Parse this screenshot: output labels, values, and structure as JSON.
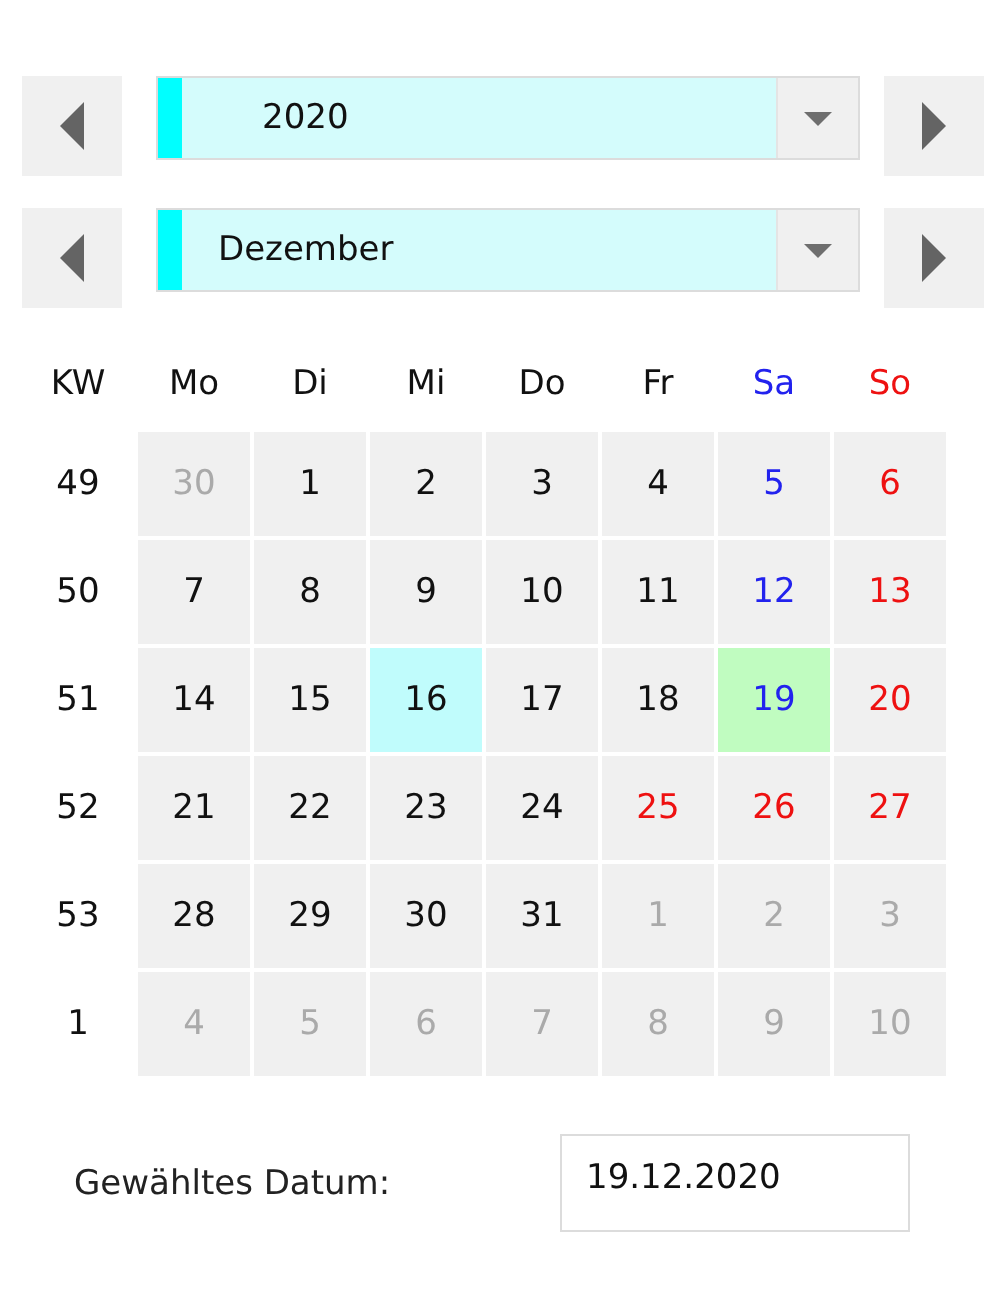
{
  "selectors": [
    {
      "kind": "year",
      "value": "2020"
    },
    {
      "kind": "month",
      "value": "Dezember"
    }
  ],
  "calendar": {
    "header": [
      {
        "label": "KW",
        "kind": "week"
      },
      {
        "label": "Mo",
        "kind": "weekday"
      },
      {
        "label": "Di",
        "kind": "weekday"
      },
      {
        "label": "Mi",
        "kind": "weekday"
      },
      {
        "label": "Do",
        "kind": "weekday"
      },
      {
        "label": "Fr",
        "kind": "weekday"
      },
      {
        "label": "Sa",
        "kind": "saturday"
      },
      {
        "label": "So",
        "kind": "sunday"
      }
    ],
    "weeks": [
      {
        "week": "49",
        "days": [
          {
            "label": "30",
            "kind": "outside",
            "today": false,
            "selected": false
          },
          {
            "label": "1",
            "kind": "weekday",
            "today": false,
            "selected": false
          },
          {
            "label": "2",
            "kind": "weekday",
            "today": false,
            "selected": false
          },
          {
            "label": "3",
            "kind": "weekday",
            "today": false,
            "selected": false
          },
          {
            "label": "4",
            "kind": "weekday",
            "today": false,
            "selected": false
          },
          {
            "label": "5",
            "kind": "saturday",
            "today": false,
            "selected": false
          },
          {
            "label": "6",
            "kind": "sunday",
            "today": false,
            "selected": false
          }
        ]
      },
      {
        "week": "50",
        "days": [
          {
            "label": "7",
            "kind": "weekday",
            "today": false,
            "selected": false
          },
          {
            "label": "8",
            "kind": "weekday",
            "today": false,
            "selected": false
          },
          {
            "label": "9",
            "kind": "weekday",
            "today": false,
            "selected": false
          },
          {
            "label": "10",
            "kind": "weekday",
            "today": false,
            "selected": false
          },
          {
            "label": "11",
            "kind": "weekday",
            "today": false,
            "selected": false
          },
          {
            "label": "12",
            "kind": "saturday",
            "today": false,
            "selected": false
          },
          {
            "label": "13",
            "kind": "sunday",
            "today": false,
            "selected": false
          }
        ]
      },
      {
        "week": "51",
        "days": [
          {
            "label": "14",
            "kind": "weekday",
            "today": false,
            "selected": false
          },
          {
            "label": "15",
            "kind": "weekday",
            "today": false,
            "selected": false
          },
          {
            "label": "16",
            "kind": "weekday",
            "today": true,
            "selected": false
          },
          {
            "label": "17",
            "kind": "weekday",
            "today": false,
            "selected": false
          },
          {
            "label": "18",
            "kind": "weekday",
            "today": false,
            "selected": false
          },
          {
            "label": "19",
            "kind": "saturday",
            "today": false,
            "selected": true
          },
          {
            "label": "20",
            "kind": "sunday",
            "today": false,
            "selected": false
          }
        ]
      },
      {
        "week": "52",
        "days": [
          {
            "label": "21",
            "kind": "weekday",
            "today": false,
            "selected": false
          },
          {
            "label": "22",
            "kind": "weekday",
            "today": false,
            "selected": false
          },
          {
            "label": "23",
            "kind": "weekday",
            "today": false,
            "selected": false
          },
          {
            "label": "24",
            "kind": "weekday",
            "today": false,
            "selected": false
          },
          {
            "label": "25",
            "kind": "holiday",
            "today": false,
            "selected": false
          },
          {
            "label": "26",
            "kind": "holiday",
            "today": false,
            "selected": false
          },
          {
            "label": "27",
            "kind": "sunday",
            "today": false,
            "selected": false
          }
        ]
      },
      {
        "week": "53",
        "days": [
          {
            "label": "28",
            "kind": "weekday",
            "today": false,
            "selected": false
          },
          {
            "label": "29",
            "kind": "weekday",
            "today": false,
            "selected": false
          },
          {
            "label": "30",
            "kind": "weekday",
            "today": false,
            "selected": false
          },
          {
            "label": "31",
            "kind": "weekday",
            "today": false,
            "selected": false
          },
          {
            "label": "1",
            "kind": "outside",
            "today": false,
            "selected": false
          },
          {
            "label": "2",
            "kind": "outside",
            "today": false,
            "selected": false
          },
          {
            "label": "3",
            "kind": "outside",
            "today": false,
            "selected": false
          }
        ]
      },
      {
        "week": "1",
        "days": [
          {
            "label": "4",
            "kind": "outside",
            "today": false,
            "selected": false
          },
          {
            "label": "5",
            "kind": "outside",
            "today": false,
            "selected": false
          },
          {
            "label": "6",
            "kind": "outside",
            "today": false,
            "selected": false
          },
          {
            "label": "7",
            "kind": "outside",
            "today": false,
            "selected": false
          },
          {
            "label": "8",
            "kind": "outside",
            "today": false,
            "selected": false
          },
          {
            "label": "9",
            "kind": "outside",
            "today": false,
            "selected": false
          },
          {
            "label": "10",
            "kind": "outside",
            "today": false,
            "selected": false
          }
        ]
      }
    ]
  },
  "selected_date": {
    "label": "Gewähltes Datum:",
    "value": "19.12.2020"
  }
}
